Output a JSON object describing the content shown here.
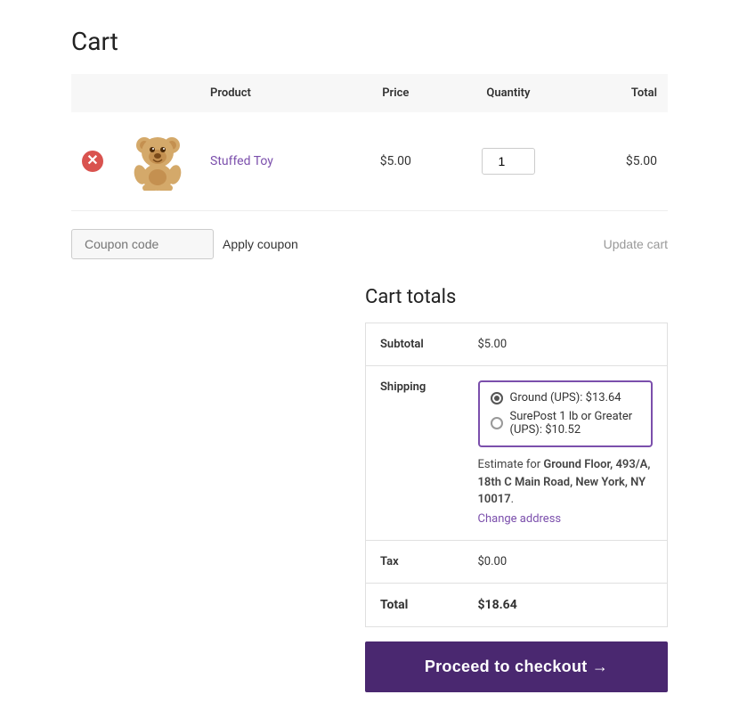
{
  "page": {
    "title": "Cart"
  },
  "table": {
    "headers": {
      "product": "Product",
      "price": "Price",
      "quantity": "Quantity",
      "total": "Total"
    },
    "rows": [
      {
        "id": "stuffed-toy",
        "product_name": "Stuffed Toy",
        "price": "$5.00",
        "quantity": "1",
        "total": "$5.00"
      }
    ]
  },
  "coupon": {
    "placeholder": "Coupon code",
    "apply_label": "Apply coupon",
    "update_label": "Update cart"
  },
  "cart_totals": {
    "title": "Cart totals",
    "subtotal_label": "Subtotal",
    "subtotal_value": "$5.00",
    "shipping_label": "Shipping",
    "shipping_options": [
      {
        "label": "Ground (UPS): $13.64",
        "selected": true
      },
      {
        "label": "SurePost 1 lb or Greater (UPS): $10.52",
        "selected": false
      }
    ],
    "shipping_estimate_text": "Estimate for ",
    "shipping_address_bold": "Ground Floor, 493/A, 18th C Main Road, New York, NY 10017",
    "change_address_label": "Change address",
    "tax_label": "Tax",
    "tax_value": "$0.00",
    "total_label": "Total",
    "total_value": "$18.64"
  },
  "checkout": {
    "button_label": "Proceed to checkout →"
  }
}
